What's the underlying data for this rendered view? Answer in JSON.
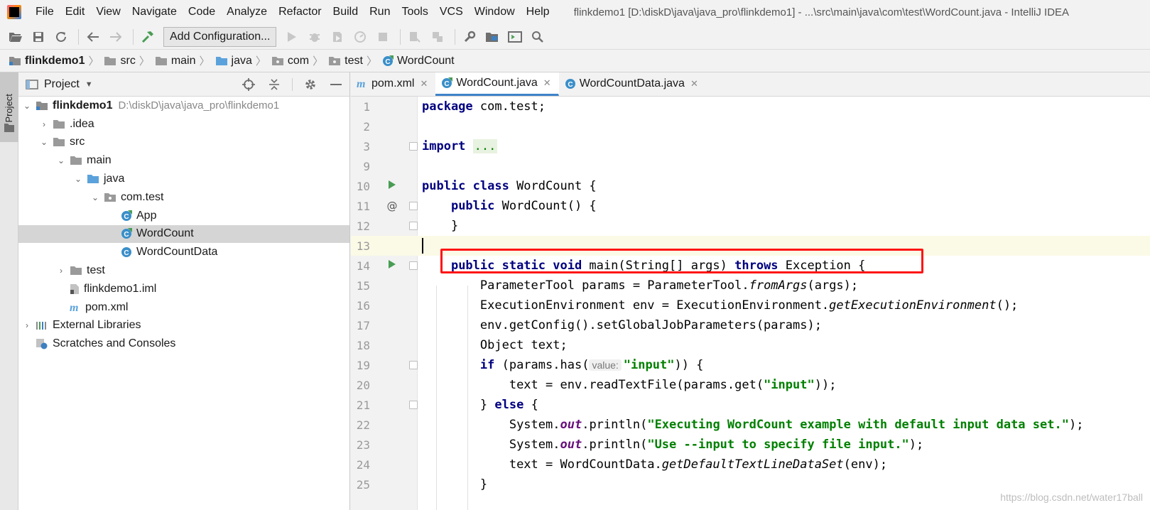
{
  "menubar": {
    "items": [
      "File",
      "Edit",
      "View",
      "Navigate",
      "Code",
      "Analyze",
      "Refactor",
      "Build",
      "Run",
      "Tools",
      "VCS",
      "Window",
      "Help"
    ],
    "window_title": "flinkdemo1 [D:\\diskD\\java\\java_pro\\flinkdemo1] - ...\\src\\main\\java\\com\\test\\WordCount.java - IntelliJ IDEA"
  },
  "toolbar": {
    "run_config_label": "Add Configuration..."
  },
  "breadcrumb": [
    "flinkdemo1",
    "src",
    "main",
    "java",
    "com",
    "test",
    "WordCount"
  ],
  "sidestripe": {
    "label": "1: Project"
  },
  "project": {
    "title": "Project",
    "root_label": "flinkdemo1",
    "root_path": "D:\\diskD\\java\\java_pro\\flinkdemo1",
    "tree": {
      "idea": ".idea",
      "src": "src",
      "main": "main",
      "java": "java",
      "package": "com.test",
      "app": "App",
      "wordcount": "WordCount",
      "wordcountdata": "WordCountData",
      "test": "test",
      "iml": "flinkdemo1.iml",
      "pom": "pom.xml",
      "ext_libs": "External Libraries",
      "scratches": "Scratches and Consoles"
    }
  },
  "editor": {
    "tabs": [
      "pom.xml",
      "WordCount.java",
      "WordCountData.java"
    ],
    "active_tab": "WordCount.java",
    "line_numbers": [
      "1",
      "2",
      "3",
      "9",
      "10",
      "11",
      "12",
      "13",
      "14",
      "15",
      "16",
      "17",
      "18",
      "19",
      "20",
      "21",
      "22",
      "23",
      "24",
      "25"
    ],
    "code": {
      "l1_kw": "package",
      "l1_rest": " com.test;",
      "l3_kw": "import",
      "l3_fold": "...",
      "l10_kw": "public class",
      "l10_rest": " WordCount {",
      "l11_kw": "public",
      "l11_rest": " WordCount() {",
      "l12": "}",
      "l14_kw1": "public static void",
      "l14_mid": " main(String[] args) ",
      "l14_kw2": "throws",
      "l14_rest": " Exception {",
      "l15_a": "ParameterTool params = ParameterTool.",
      "l15_b": "fromArgs",
      "l15_c": "(args);",
      "l16_a": "ExecutionEnvironment env = ExecutionEnvironment.",
      "l16_b": "getExecutionEnvironment",
      "l16_c": "();",
      "l17": "env.getConfig().setGlobalJobParameters(params);",
      "l18": "Object text;",
      "l19_kw": "if",
      "l19_a": " (params.has(",
      "l19_hint": "value:",
      "l19_str": "\"input\"",
      "l19_b": ")) {",
      "l20_a": "text = env.readTextFile(params.get(",
      "l20_str": "\"input\"",
      "l20_b": "));",
      "l21_a": "} ",
      "l21_kw": "else",
      "l21_b": " {",
      "l22_a": "System.",
      "l22_field": "out",
      "l22_b": ".println(",
      "l22_str": "\"Executing WordCount example with default input data set.\"",
      "l22_c": ");",
      "l23_a": "System.",
      "l23_field": "out",
      "l23_b": ".println(",
      "l23_str": "\"Use --input to specify file input.\"",
      "l23_c": ");",
      "l24_a": "text = WordCountData.",
      "l24_b": "getDefaultTextLineDataSet",
      "l24_c": "(env);",
      "l25": "}"
    },
    "watermark": "https://blog.csdn.net/water17ball"
  },
  "colors": {
    "keyword": "#000080",
    "string": "#008000",
    "static_field": "#660e7a",
    "highlight_box": "#ff1414",
    "active_tab_underline": "#4083c9",
    "run_gutter": "#499c54"
  },
  "icons": {
    "toolbar": [
      "open-icon",
      "save-icon",
      "sync-icon",
      "back-icon",
      "forward-icon",
      "build-hammer-icon",
      "run-icon",
      "debug-icon",
      "coverage-icon",
      "profile-icon",
      "stop-icon",
      "attach-icon",
      "vcs-icon",
      "settings-wrench-icon",
      "project-structure-icon",
      "terminal-icon",
      "search-icon"
    ]
  }
}
